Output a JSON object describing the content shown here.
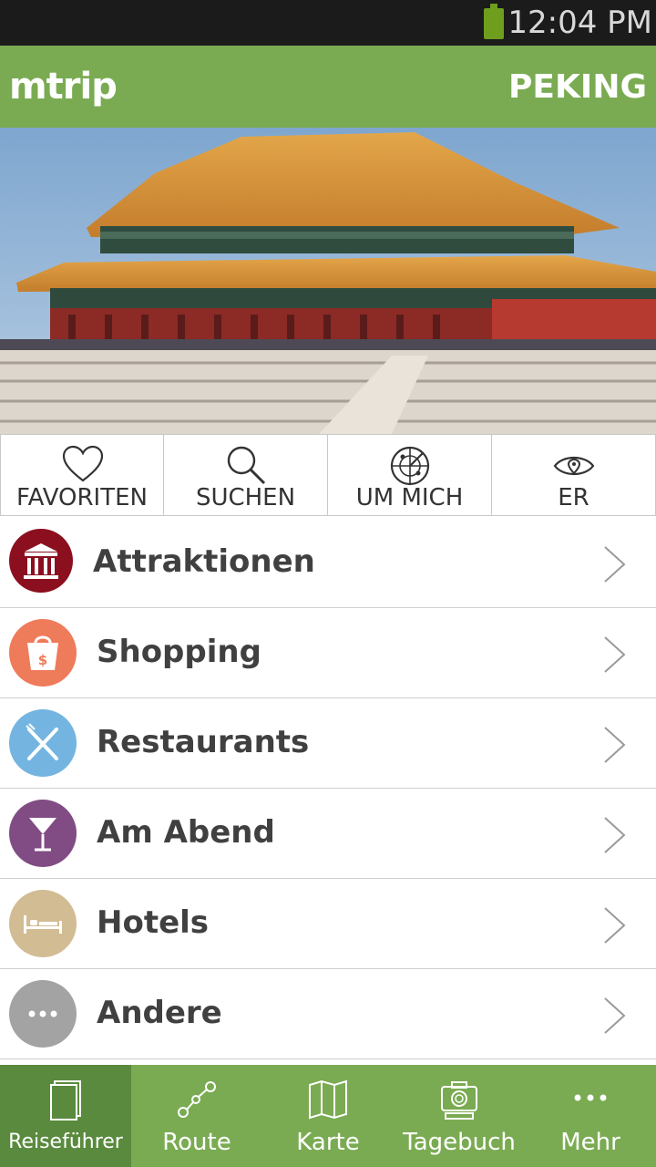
{
  "status": {
    "time": "12:04 PM"
  },
  "header": {
    "logo": "mtrip",
    "city": "PEKING"
  },
  "quick_actions": [
    {
      "label": "FAVORITEN",
      "icon": "heart-icon"
    },
    {
      "label": "SUCHEN",
      "icon": "search-icon"
    },
    {
      "label": "UM MICH",
      "icon": "radar-icon"
    },
    {
      "label": "ER",
      "icon": "eye-icon"
    }
  ],
  "categories": [
    {
      "label": "Attraktionen",
      "icon": "museum-icon",
      "color": "#8b0f1f"
    },
    {
      "label": "Shopping",
      "icon": "shopping-bag-icon",
      "color": "#ee7b5a"
    },
    {
      "label": "Restaurants",
      "icon": "cutlery-icon",
      "color": "#73b5e0"
    },
    {
      "label": "Am Abend",
      "icon": "cocktail-icon",
      "color": "#814c84"
    },
    {
      "label": "Hotels",
      "icon": "bed-icon",
      "color": "#d2bc94"
    },
    {
      "label": "Andere",
      "icon": "more-icon",
      "color": "#a3a3a3"
    }
  ],
  "tabs": [
    {
      "label": "Reiseführer",
      "icon": "guide-icon",
      "active": true
    },
    {
      "label": "Route",
      "icon": "route-icon"
    },
    {
      "label": "Karte",
      "icon": "map-icon"
    },
    {
      "label": "Tagebuch",
      "icon": "camera-icon"
    },
    {
      "label": "Mehr",
      "icon": "more-icon"
    }
  ],
  "colors": {
    "brand": "#7aab52",
    "brand_dark": "#5a8a3d"
  }
}
